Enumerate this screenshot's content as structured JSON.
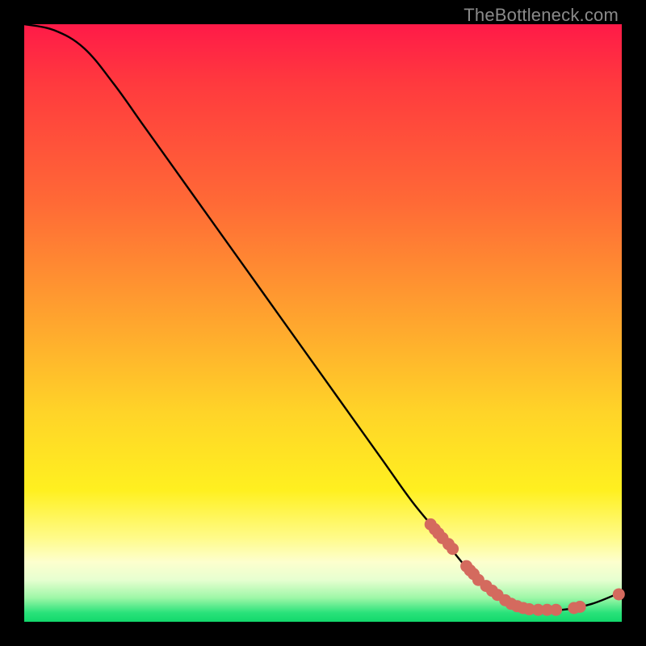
{
  "watermark": "TheBottleneck.com",
  "colors": {
    "curve": "#000000",
    "marker_fill": "#d46a5e",
    "marker_stroke": "#b24f45"
  },
  "chart_data": {
    "type": "line",
    "title": "",
    "xlabel": "",
    "ylabel": "",
    "xlim": [
      0,
      100
    ],
    "ylim": [
      0,
      100
    ],
    "curve": {
      "x": [
        0,
        5,
        10,
        15,
        20,
        25,
        30,
        35,
        40,
        45,
        50,
        55,
        60,
        65,
        70,
        75,
        80,
        85,
        90,
        95,
        100
      ],
      "y": [
        100,
        99,
        96,
        90,
        83,
        76,
        69,
        62,
        55,
        48,
        41,
        34,
        27,
        20,
        14,
        8,
        4,
        2,
        2,
        3,
        5
      ]
    },
    "markers": {
      "x": [
        68.0,
        68.7,
        69.3,
        70.0,
        71.0,
        71.7,
        74.0,
        74.6,
        75.2,
        76.0,
        77.3,
        78.3,
        79.2,
        80.5,
        81.5,
        82.5,
        83.5,
        84.5,
        86.0,
        87.5,
        89.0,
        92.0,
        93.0,
        99.5
      ],
      "y": [
        16.3,
        15.5,
        14.8,
        14.0,
        13.0,
        12.2,
        9.3,
        8.6,
        8.0,
        7.0,
        6.0,
        5.2,
        4.5,
        3.6,
        3.0,
        2.6,
        2.3,
        2.1,
        2.0,
        2.0,
        2.0,
        2.3,
        2.5,
        4.6
      ]
    }
  }
}
